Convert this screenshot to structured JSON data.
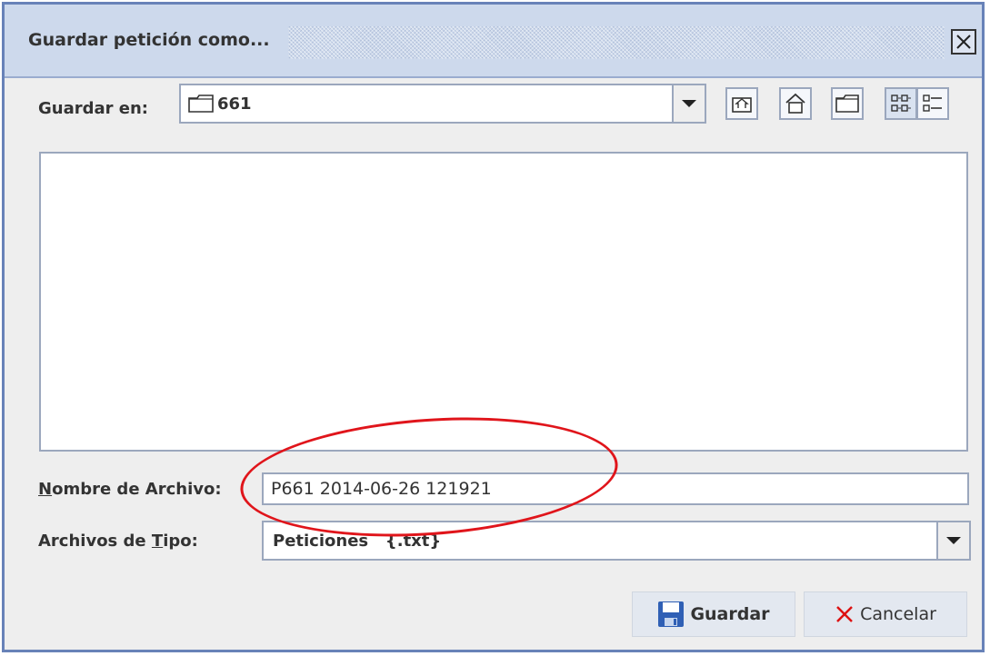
{
  "dialog": {
    "title": "Guardar petición como...",
    "close_icon": "close-icon"
  },
  "save_in": {
    "label": "Guardar en:",
    "value": "661",
    "icon": "folder-icon"
  },
  "toolbar": {
    "buttons": [
      "up-folder-icon",
      "home-icon",
      "new-folder-icon",
      "list-view-icon",
      "details-view-icon"
    ]
  },
  "filename": {
    "label_underlined": "N",
    "label_rest": "ombre de Archivo:",
    "value": "P661 2014-06-26 121921"
  },
  "filetype": {
    "label_prefix": "Archivos de ",
    "label_underlined": "T",
    "label_rest": "ipo:",
    "value": "Peticiones   {.txt}"
  },
  "buttons": {
    "save_label": "Guardar",
    "save_icon": "floppy-disk-icon",
    "cancel_label": "Cancelar",
    "cancel_icon": "x-icon"
  },
  "colors": {
    "annotation": "#e0151b",
    "title_bar": "#cdd9ec",
    "border": "#6882b8"
  }
}
